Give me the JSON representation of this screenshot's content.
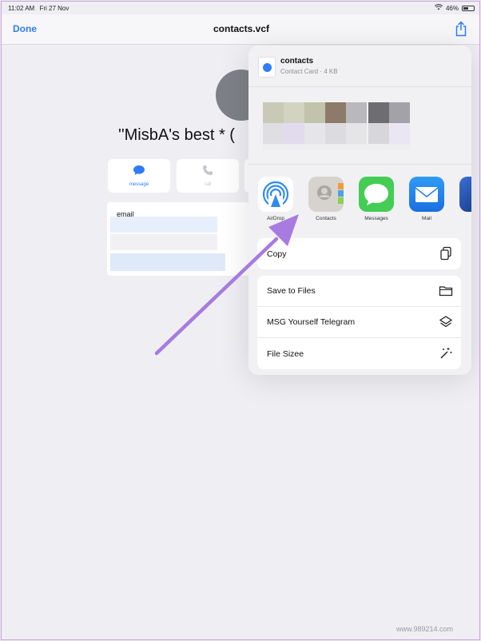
{
  "status": {
    "time": "11:02 AM",
    "date": "Fri 27 Nov",
    "battery": "46%"
  },
  "nav": {
    "done_label": "Done",
    "title": "contacts.vcf"
  },
  "contact": {
    "name": "''MisbA's best * (",
    "actions": [
      {
        "label": "message",
        "enabled": true
      },
      {
        "label": "call",
        "enabled": false
      }
    ],
    "email_label": "email"
  },
  "share_sheet": {
    "file_name": "contacts",
    "file_meta": "Contact Card · 4 KB",
    "apps": [
      {
        "label": "AirDrop",
        "icon": "airdrop-icon"
      },
      {
        "label": "Contacts",
        "icon": "contacts-icon"
      },
      {
        "label": "Messages",
        "icon": "messages-icon"
      },
      {
        "label": "Mail",
        "icon": "mail-icon"
      }
    ],
    "actions_group1": [
      {
        "label": "Copy",
        "icon": "copy-icon"
      }
    ],
    "actions_group2": [
      {
        "label": "Save to Files",
        "icon": "folder-icon"
      },
      {
        "label": "MSG Yourself Telegram",
        "icon": "layers-icon"
      },
      {
        "label": "File Sizee",
        "icon": "magic-wand-icon"
      }
    ]
  },
  "colors": {
    "accent": "#2f7cf6",
    "arrow": "#a77be0"
  },
  "watermark": "www.989214.com"
}
